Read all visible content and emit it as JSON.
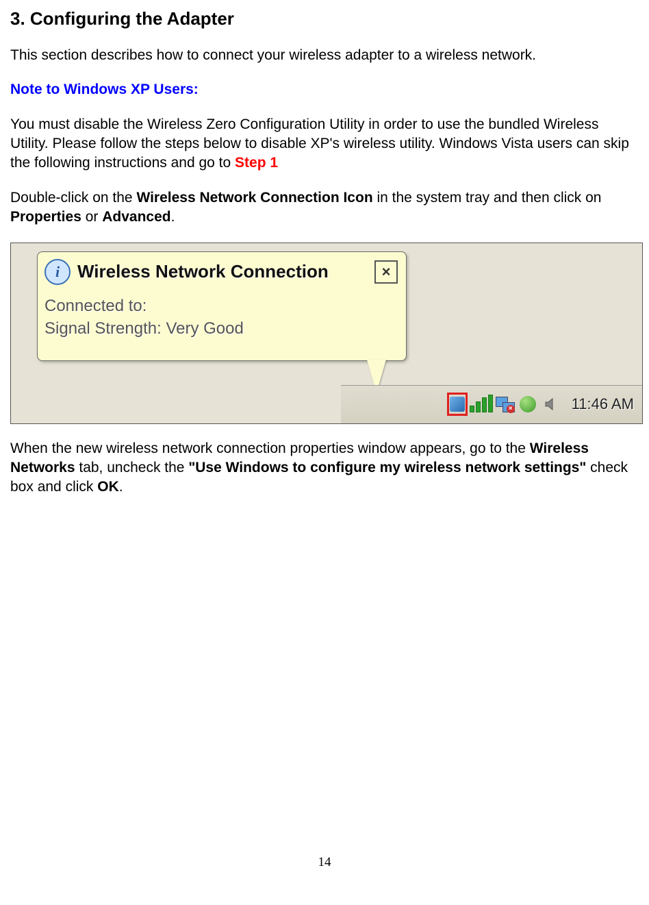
{
  "heading": "3. Configuring the Adapter",
  "intro": "This section describes how to connect your wireless adapter to a wireless network.",
  "note_header": "Note to Windows XP Users:",
  "p2_part1": "You must disable the Wireless Zero Configuration Utility in order to use the bundled Wireless Utility.  Please follow the steps below to disable XP's wireless utility.  Windows Vista users can skip the following instructions and go to ",
  "step1": "Step 1",
  "p3_a": "Double-click on the ",
  "p3_b": "Wireless Network Connection Icon",
  "p3_c": " in the system tray and then click on ",
  "p3_d": "Properties",
  "p3_e": " or ",
  "p3_f": "Advanced",
  "p3_g": ".",
  "balloon": {
    "title": "Wireless Network Connection",
    "line1": "Connected to:",
    "line2": "Signal Strength: Very Good",
    "close": "×"
  },
  "info_icon_glyph": "i",
  "clock": "11:46 AM",
  "p4_a": "When the new wireless network connection properties window appears, go to the ",
  "p4_b": "Wireless Networks",
  "p4_c": " tab, uncheck the ",
  "p4_d": "\"Use Windows to configure my wireless network settings\"",
  "p4_e": " check box and click ",
  "p4_f": "OK",
  "p4_g": ".",
  "page_number": "14"
}
